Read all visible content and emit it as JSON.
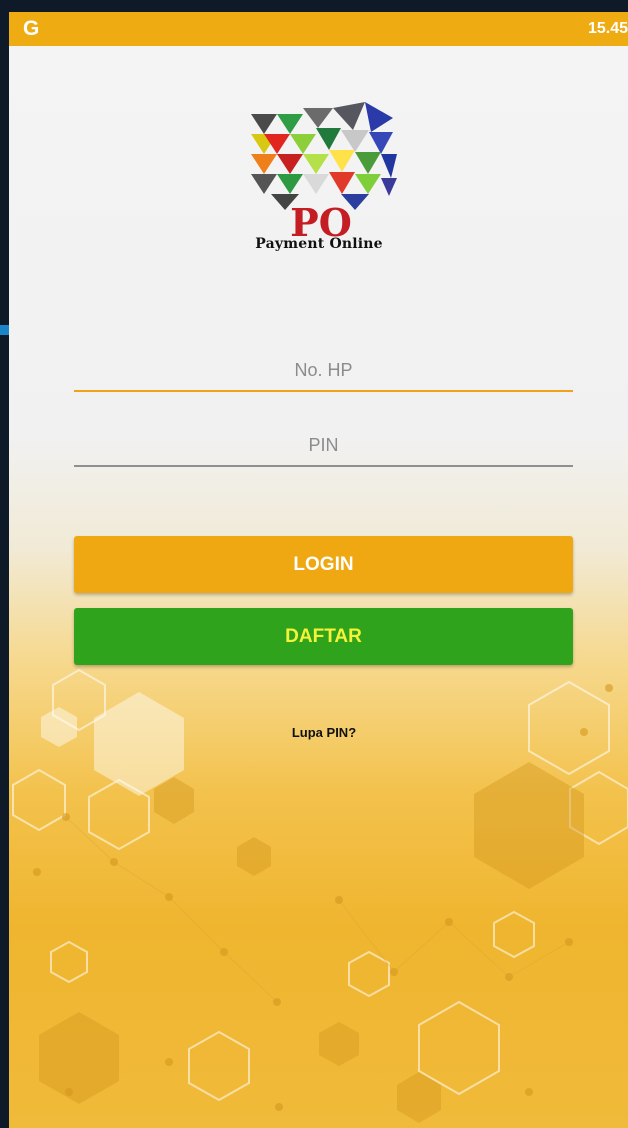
{
  "status_bar": {
    "app_icon_letter": "G",
    "time": "15.45",
    "color": "#eeab12"
  },
  "logo": {
    "letters": "PO",
    "caption": "Payment Online",
    "icon": "po-logo-mosaic-icon"
  },
  "form": {
    "phone": {
      "placeholder": "No. HP",
      "value": ""
    },
    "pin": {
      "placeholder": "PIN",
      "value": ""
    }
  },
  "buttons": {
    "login_label": "LOGIN",
    "daftar_label": "DAFTAR"
  },
  "forgot_link": "Lupa PIN?",
  "colors": {
    "accent": "#efa712",
    "secondary": "#2fa31b",
    "secondary_text": "#f6f23a"
  }
}
